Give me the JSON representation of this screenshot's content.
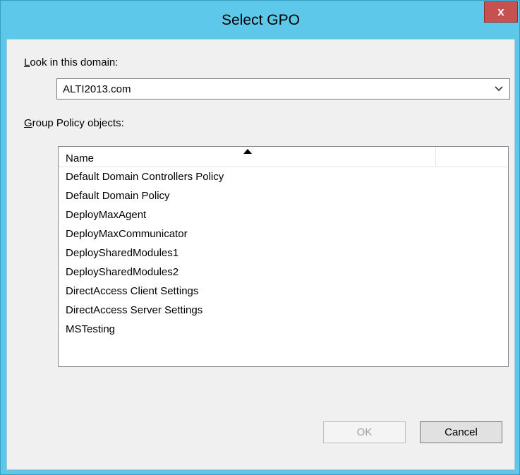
{
  "dialog": {
    "title": "Select GPO",
    "close_glyph": "x"
  },
  "domain": {
    "label_accel": "L",
    "label_rest": "ook in this domain:",
    "selected_value": "ALTI2013.com",
    "dropdown_icon": "chevron-down-icon"
  },
  "gpo": {
    "label_accel": "G",
    "label_rest": "roup Policy objects:",
    "columns": [
      "Name",
      ""
    ],
    "sort_icon": "sort-ascending-icon",
    "items": [
      "Default Domain Controllers Policy",
      "Default Domain Policy",
      "DeployMaxAgent",
      "DeployMaxCommunicator",
      "DeploySharedModules1",
      "DeploySharedModules2",
      "DirectAccess Client Settings",
      "DirectAccess Server Settings",
      "MSTesting"
    ]
  },
  "buttons": {
    "ok": "OK",
    "cancel": "Cancel"
  },
  "colors": {
    "titlebar": "#5ec8ea",
    "close": "#c75050",
    "client": "#f0f0f0"
  }
}
